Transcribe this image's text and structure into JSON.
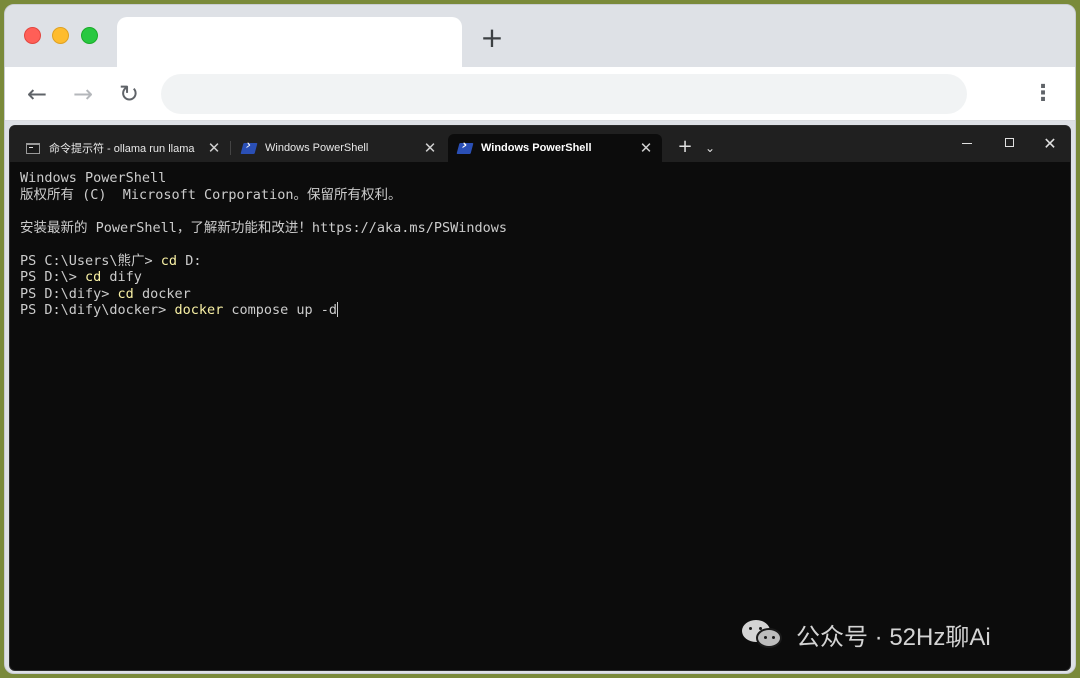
{
  "browser": {
    "new_tab_symbol": "+",
    "back_symbol": "←",
    "forward_symbol": "→",
    "reload_symbol": "↻",
    "menu_symbol": "⋮",
    "address": ""
  },
  "terminal": {
    "tabs": [
      {
        "label": "命令提示符 - ollama  run llama",
        "icon": "cmd-icon",
        "close": "✕"
      },
      {
        "label": "Windows PowerShell",
        "icon": "powershell-icon",
        "close": "✕"
      },
      {
        "label": "Windows PowerShell",
        "icon": "powershell-icon",
        "close": "✕",
        "active": true
      }
    ],
    "new_tab_symbol": "+",
    "dropdown_symbol": "⌄",
    "close_symbol": "✕",
    "lines": {
      "l1": "Windows PowerShell",
      "l2": "版权所有 (C)  Microsoft Corporation。保留所有权利。",
      "l3": "",
      "l4": "安装最新的 PowerShell，了解新功能和改进！https://aka.ms/PSWindows",
      "l5": "",
      "l6_prompt": "PS C:\\Users\\熊广> ",
      "l6_cmd": "cd",
      "l6_arg": " D:",
      "l7_prompt": "PS D:\\> ",
      "l7_cmd": "cd",
      "l7_arg": " dify",
      "l8_prompt": "PS D:\\dify> ",
      "l8_cmd": "cd",
      "l8_arg": " docker",
      "l9_prompt": "PS D:\\dify\\docker> ",
      "l9_cmd": "docker",
      "l9_arg": " compose up -d"
    }
  },
  "watermark": {
    "text": "公众号 · 52Hz聊Ai",
    "icon": "wechat-icon"
  },
  "colors": {
    "terminal_bg": "#0c0c0c",
    "terminal_fg": "#cccccc",
    "command_color": "#f9f1a5",
    "browser_chrome": "#dee1e6"
  }
}
